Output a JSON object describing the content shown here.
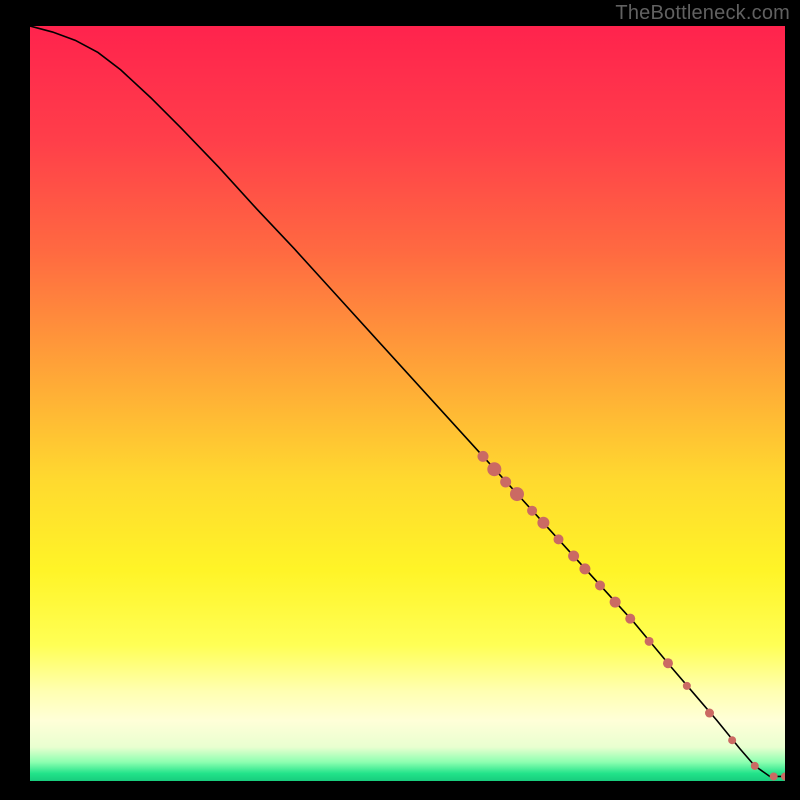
{
  "attribution": "TheBottleneck.com",
  "colors": {
    "background": "#000000",
    "curve_stroke": "#000000",
    "dot_fill": "#cb6a63",
    "gradient_stops": [
      {
        "offset": 0.0,
        "color": "#ff234d"
      },
      {
        "offset": 0.15,
        "color": "#ff3e4a"
      },
      {
        "offset": 0.3,
        "color": "#ff6a41"
      },
      {
        "offset": 0.45,
        "color": "#ffa238"
      },
      {
        "offset": 0.6,
        "color": "#ffd92f"
      },
      {
        "offset": 0.72,
        "color": "#fff427"
      },
      {
        "offset": 0.82,
        "color": "#ffff55"
      },
      {
        "offset": 0.88,
        "color": "#ffffb0"
      },
      {
        "offset": 0.92,
        "color": "#ffffd8"
      },
      {
        "offset": 0.955,
        "color": "#e9ffd0"
      },
      {
        "offset": 0.975,
        "color": "#8dffb0"
      },
      {
        "offset": 0.99,
        "color": "#22e38a"
      },
      {
        "offset": 1.0,
        "color": "#18cc7d"
      }
    ]
  },
  "chart_data": {
    "type": "line",
    "title": "",
    "xlabel": "",
    "ylabel": "",
    "xlim": [
      0,
      100
    ],
    "ylim": [
      0,
      100
    ],
    "series": [
      {
        "name": "curve",
        "x": [
          0,
          3,
          6,
          9,
          12,
          16,
          20,
          25,
          30,
          35,
          40,
          45,
          50,
          55,
          60,
          65,
          70,
          75,
          80,
          85,
          88,
          91,
          94,
          96,
          98,
          100
        ],
        "y": [
          100,
          99.2,
          98.1,
          96.5,
          94.2,
          90.5,
          86.5,
          81.3,
          75.8,
          70.5,
          65.0,
          59.5,
          54.0,
          48.5,
          43.0,
          37.5,
          32.0,
          26.5,
          21.0,
          15.0,
          11.5,
          8.0,
          4.3,
          2.0,
          0.6,
          0.6
        ]
      }
    ],
    "scatter_points": [
      {
        "x": 60.0,
        "y": 43.0,
        "r": 5.5
      },
      {
        "x": 61.5,
        "y": 41.3,
        "r": 7.0
      },
      {
        "x": 63.0,
        "y": 39.6,
        "r": 5.5
      },
      {
        "x": 64.5,
        "y": 38.0,
        "r": 7.0
      },
      {
        "x": 66.5,
        "y": 35.8,
        "r": 5.0
      },
      {
        "x": 68.0,
        "y": 34.2,
        "r": 6.0
      },
      {
        "x": 70.0,
        "y": 32.0,
        "r": 5.0
      },
      {
        "x": 72.0,
        "y": 29.8,
        "r": 5.5
      },
      {
        "x": 73.5,
        "y": 28.1,
        "r": 5.5
      },
      {
        "x": 75.5,
        "y": 25.9,
        "r": 5.0
      },
      {
        "x": 77.5,
        "y": 23.7,
        "r": 5.5
      },
      {
        "x": 79.5,
        "y": 21.5,
        "r": 5.0
      },
      {
        "x": 82.0,
        "y": 18.5,
        "r": 4.5
      },
      {
        "x": 84.5,
        "y": 15.6,
        "r": 5.0
      },
      {
        "x": 87.0,
        "y": 12.6,
        "r": 4.0
      },
      {
        "x": 90.0,
        "y": 9.0,
        "r": 4.5
      },
      {
        "x": 93.0,
        "y": 5.4,
        "r": 4.0
      },
      {
        "x": 96.0,
        "y": 2.0,
        "r": 4.0
      },
      {
        "x": 98.5,
        "y": 0.6,
        "r": 4.0
      },
      {
        "x": 100.0,
        "y": 0.6,
        "r": 4.0
      }
    ]
  }
}
